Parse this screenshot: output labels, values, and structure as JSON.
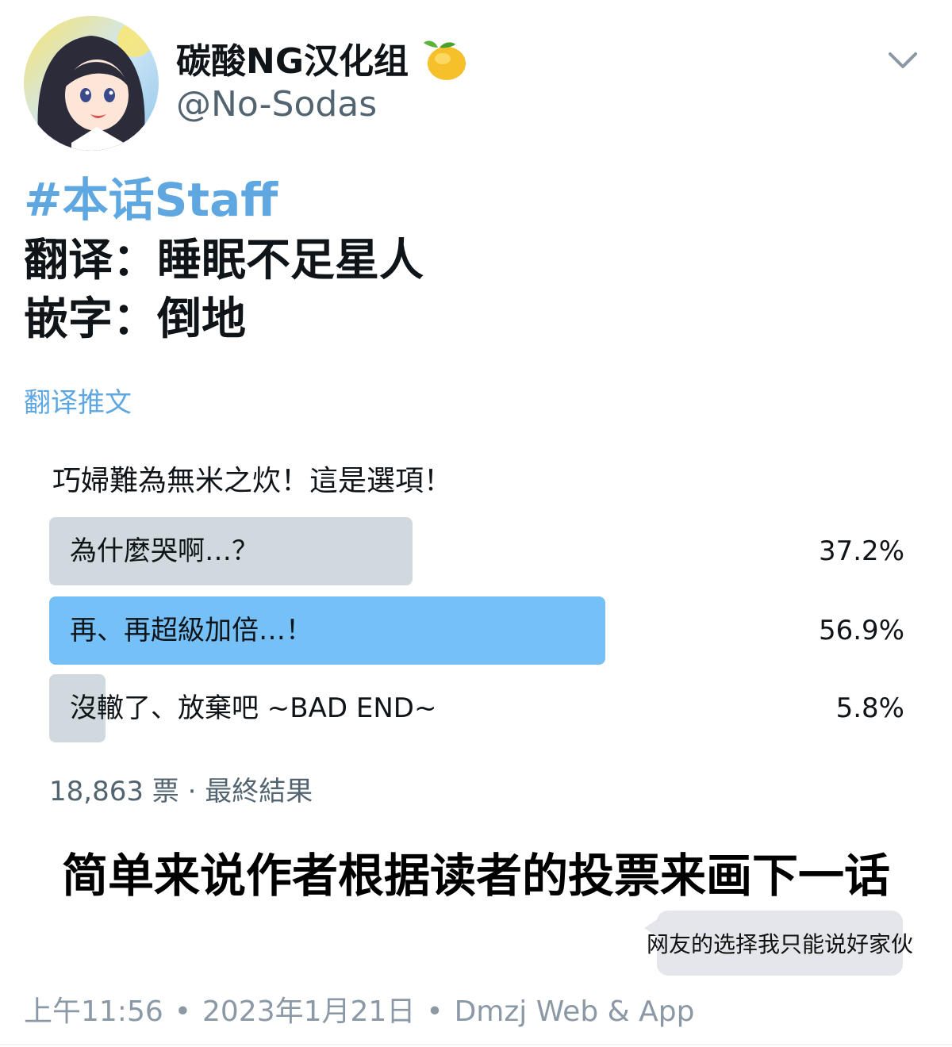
{
  "author": {
    "name": "碳酸NG汉化组",
    "handle": "@No-Sodas"
  },
  "tweet": {
    "hashtag": "#本话Staff",
    "lines": [
      "翻译：睡眠不足星人",
      "嵌字：倒地"
    ],
    "translate_link": "翻译推文"
  },
  "poll": {
    "question": "巧婦難為無米之炊！這是選項！",
    "options": [
      {
        "label": "為什麼哭啊…？",
        "percent": "37.2%",
        "share": 0.372,
        "leader": false
      },
      {
        "label": "再、再超級加倍…！",
        "percent": "56.9%",
        "share": 0.569,
        "leader": true
      },
      {
        "label": "沒轍了、放棄吧 ~BAD END~",
        "percent": "5.8%",
        "share": 0.058,
        "leader": false
      }
    ],
    "footer": "18,863 票 · 最終結果"
  },
  "caption": "简单来说作者根据读者的投票来画下一话",
  "bubble": "网友的选择我只能说好家伙",
  "meta": {
    "time": "上午11:56",
    "date": "2023年1月21日",
    "source": "Dmzj Web & App"
  },
  "colors": {
    "link": "#5fa7e0",
    "poll_bar": "#cfd9de",
    "poll_bar_leader": "#75c0f6",
    "muted": "#536471",
    "meta": "#8b98a5"
  }
}
